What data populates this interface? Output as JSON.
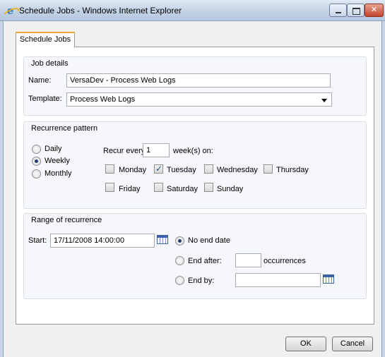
{
  "window": {
    "title": "Schedule Jobs - Windows Internet Explorer",
    "icon": "internet-explorer-icon"
  },
  "tabs": [
    {
      "label": "Schedule Jobs",
      "selected": true
    }
  ],
  "job_details": {
    "title": "Job details",
    "name_label": "Name:",
    "name_value": "VersaDev - Process Web Logs",
    "template_label": "Template:",
    "template_value": "Process Web Logs"
  },
  "recurrence": {
    "title": "Recurrence pattern",
    "options": [
      {
        "label": "Daily",
        "selected": false
      },
      {
        "label": "Weekly",
        "selected": true
      },
      {
        "label": "Monthly",
        "selected": false
      }
    ],
    "recur_every_label": "Recur every",
    "recur_every_value": "1",
    "weeks_on_label": "week(s) on:",
    "days": [
      {
        "label": "Monday",
        "checked": false
      },
      {
        "label": "Tuesday",
        "checked": true
      },
      {
        "label": "Wednesday",
        "checked": false
      },
      {
        "label": "Thursday",
        "checked": false
      },
      {
        "label": "Friday",
        "checked": false
      },
      {
        "label": "Saturday",
        "checked": false
      },
      {
        "label": "Sunday",
        "checked": false
      }
    ]
  },
  "range": {
    "title": "Range of recurrence",
    "start_label": "Start:",
    "start_value": "17/11/2008 14:00:00",
    "no_end_label": "No end date",
    "end_after_label": "End after:",
    "end_after_value": "",
    "occurrences_label": "occurrences",
    "end_by_label": "End by:",
    "end_by_value": "",
    "selected": "no_end"
  },
  "footer": {
    "ok_label": "OK",
    "cancel_label": "Cancel"
  },
  "colors": {
    "tab_accent": "#f0a33b",
    "radio_dot": "#1f3f6b",
    "calendar": "#3a62a8"
  }
}
